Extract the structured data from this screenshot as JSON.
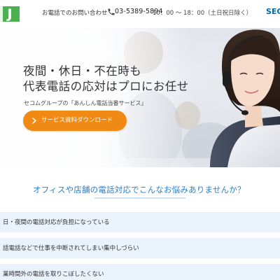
{
  "header": {
    "logo_text": "J",
    "contact_label": "お電話でのお問い合わせ",
    "phone_number": "03-5389-5894",
    "hours": "10：00 〜 18：00（土日祝日除く）",
    "brand": "SECO"
  },
  "hero": {
    "title_line1": "夜間・休日・不在時も",
    "title_line2": "代表電話の応対はプロにお任せ",
    "subtitle": "セコムグループの「あんしん電話当番サービス」",
    "cta_label": "サービス資料ダウンロード"
  },
  "question": {
    "heading": "オフィスや店舗の電話対応でこんなお悩みありませんか？"
  },
  "worries": [
    "日・夜間の電話対応が負担になっている",
    "話電話などで仕事を中断されてしまい集中しづらい",
    "業時間外の電話を取りこぼしたくない"
  ],
  "colors": {
    "accent_orange": "#f08a14",
    "accent_blue": "#2a7fc8",
    "logo_green": "#4caf50",
    "worry_bg": "#eaf3fb"
  }
}
